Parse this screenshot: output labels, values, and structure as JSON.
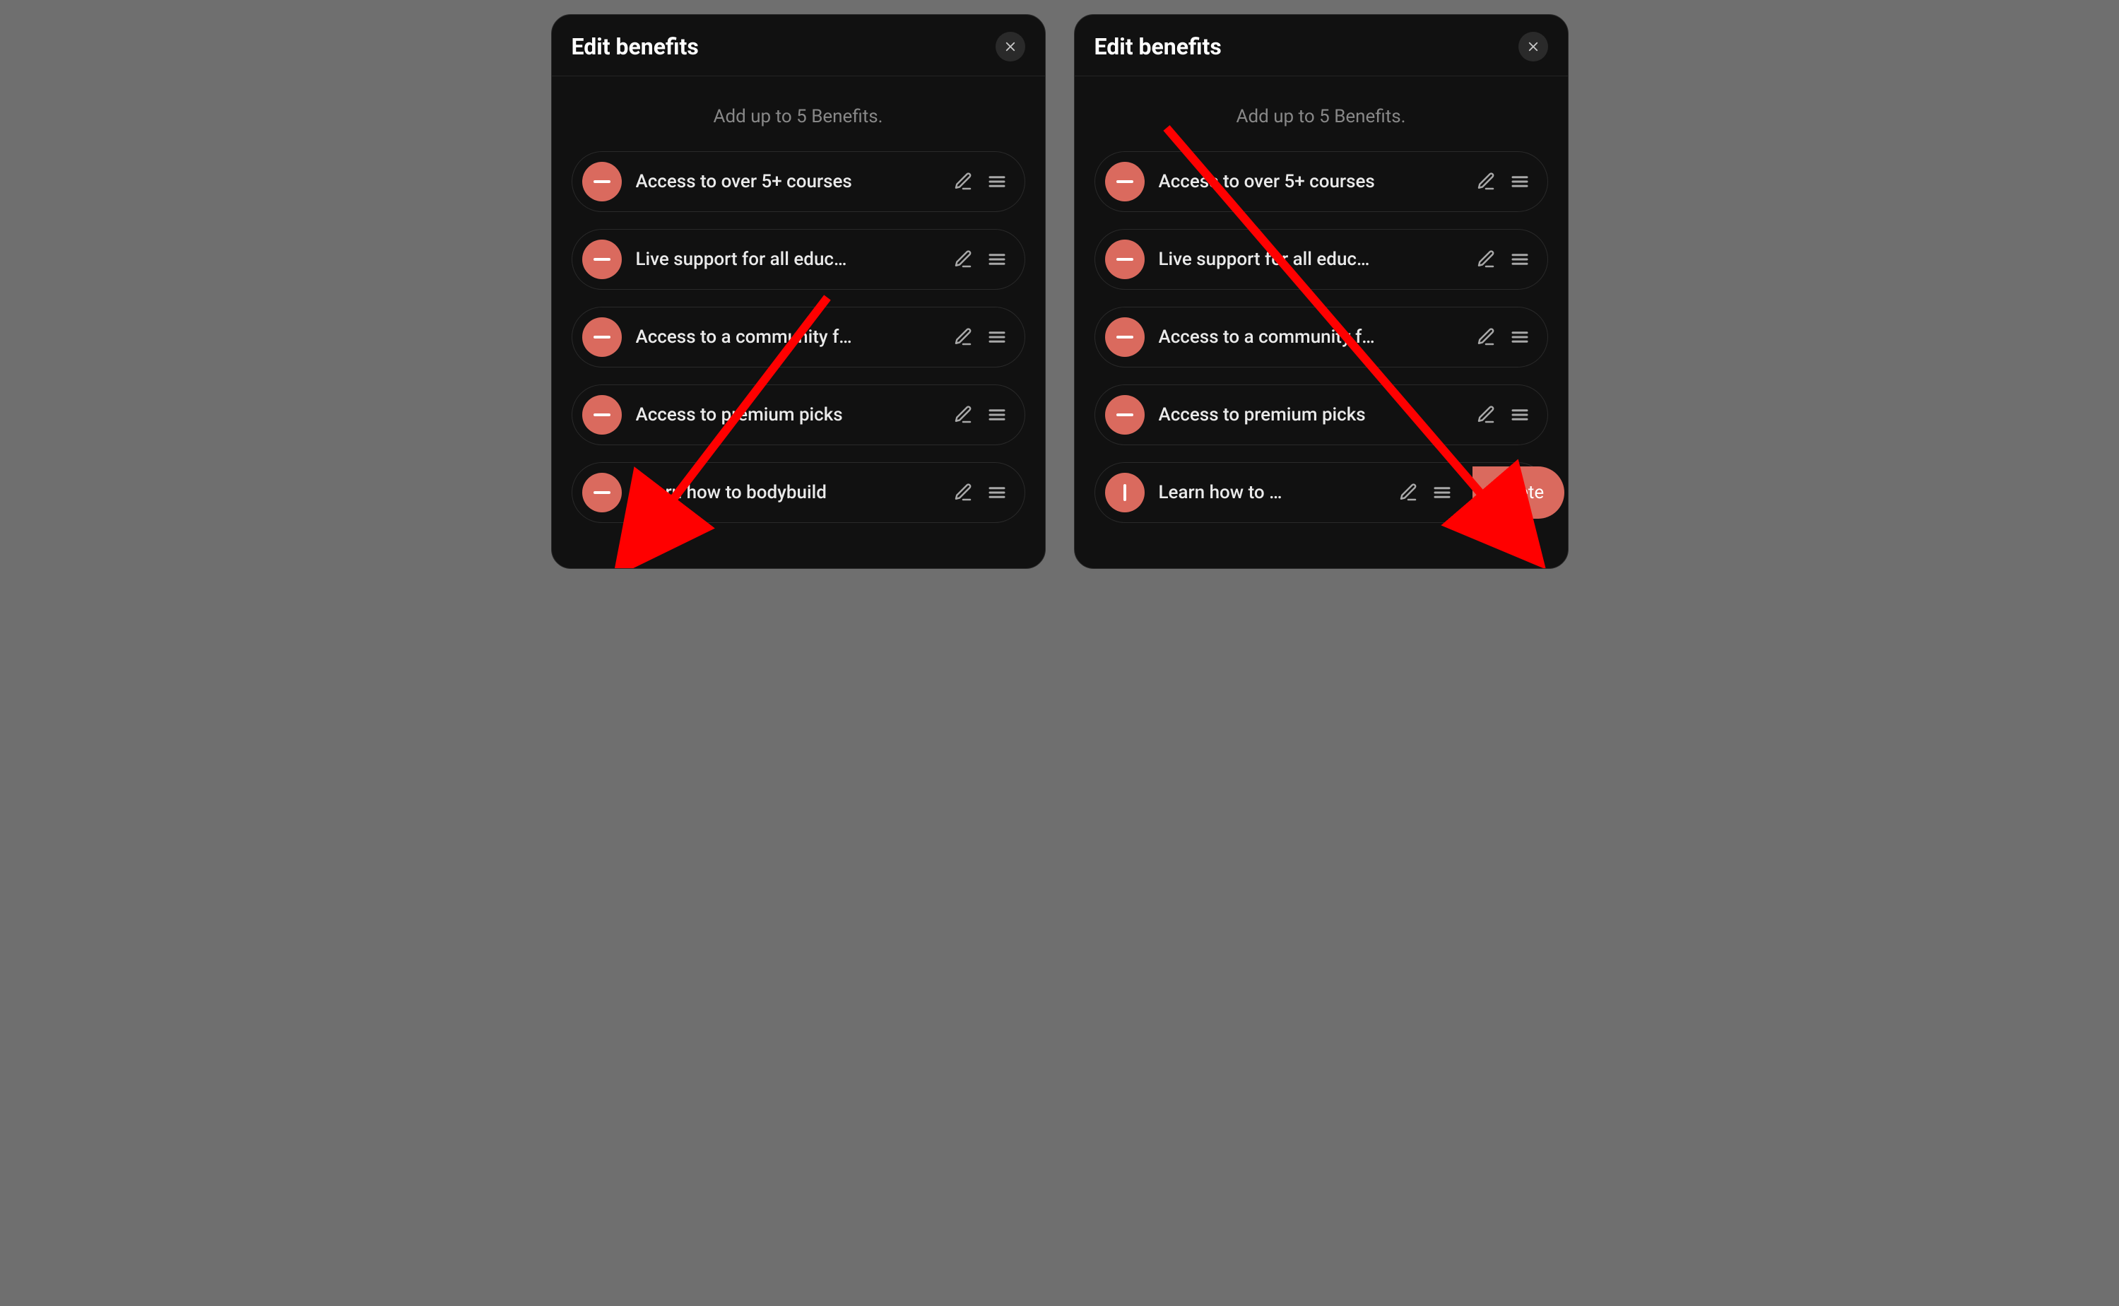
{
  "left": {
    "title": "Edit benefits",
    "subtitle": "Add up to 5 Benefits.",
    "items": [
      {
        "label": "Access to over 5+ courses"
      },
      {
        "label": "Live support for all educ…"
      },
      {
        "label": "Access to a community f…"
      },
      {
        "label": "Access to premium picks"
      },
      {
        "label": "Learn how to bodybuild"
      }
    ]
  },
  "right": {
    "title": "Edit benefits",
    "subtitle": "Add up to 5 Benefits.",
    "items": [
      {
        "label": "Access to over 5+ courses"
      },
      {
        "label": "Live support for all educ…"
      },
      {
        "label": "Access to a community f…"
      },
      {
        "label": "Access to premium picks"
      },
      {
        "label": "Learn how to …",
        "delete": "Delete"
      }
    ]
  }
}
